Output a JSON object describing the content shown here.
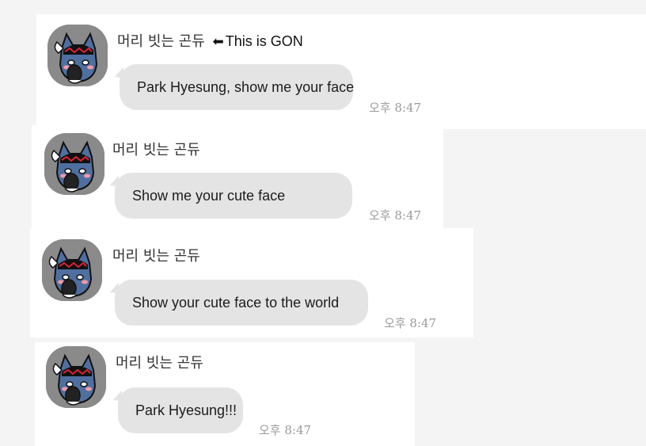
{
  "messages": [
    {
      "sender": "머리 빗는 곤듀",
      "sender_note_arrow": "⬅",
      "sender_note": "This is GON",
      "text": "Park Hyesung, show me your face",
      "time": "오후 8:47"
    },
    {
      "sender": "머리 빗는 곤듀",
      "text": "Show me your cute face",
      "time": "오후 8:47"
    },
    {
      "sender": "머리 빗는 곤듀",
      "text": "Show your cute face to the world",
      "time": "오후 8:47"
    },
    {
      "sender": "머리 빗는 곤듀",
      "text": "Park Hyesung!!!",
      "time": "오후 8:47"
    }
  ],
  "colors": {
    "bubble": "#e4e4e4",
    "avatar_bg": "#8a8a8a",
    "timestamp": "#9a9a9a"
  },
  "icons": {
    "avatar": "cat-character-combing-hair-icon",
    "arrow": "left-arrow-icon"
  }
}
